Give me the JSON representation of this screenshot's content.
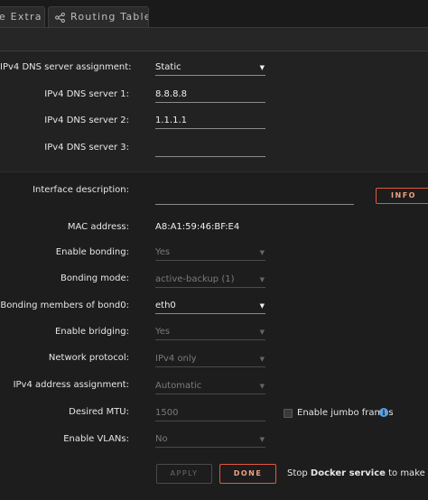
{
  "tabs": [
    {
      "label": "e Extra"
    },
    {
      "label": "Routing Table",
      "icon": "share-icon"
    }
  ],
  "dns": {
    "assignment_label": "IPv4 DNS server assignment:",
    "assignment_value": "Static",
    "server1_label": "IPv4 DNS server 1:",
    "server1_value": "8.8.8.8",
    "server2_label": "IPv4 DNS server 2:",
    "server2_value": "1.1.1.1",
    "server3_label": "IPv4 DNS server 3:",
    "server3_value": ""
  },
  "interface": {
    "description_label": "Interface description:",
    "description_value": "",
    "info_button": "INFO",
    "mac_label": "MAC address:",
    "mac_value": "A8:A1:59:46:BF:E4",
    "bonding_label": "Enable bonding:",
    "bonding_value": "Yes",
    "bonding_mode_label": "Bonding mode:",
    "bonding_mode_value": "active-backup (1)",
    "bond_members_label": "Bonding members of bond0:",
    "bond_members_value": "eth0",
    "bridging_label": "Enable bridging:",
    "bridging_value": "Yes",
    "protocol_label": "Network protocol:",
    "protocol_value": "IPv4 only",
    "ipv4_assign_label": "IPv4 address assignment:",
    "ipv4_assign_value": "Automatic",
    "mtu_label": "Desired MTU:",
    "mtu_placeholder": "1500",
    "jumbo_label": "Enable jumbo frames",
    "jumbo_checked": false,
    "vlans_label": "Enable VLANs:",
    "vlans_value": "No"
  },
  "actions": {
    "apply_label": "APPLY",
    "done_label": "DONE",
    "stop_prefix": "Stop ",
    "stop_bold": "Docker service",
    "stop_suffix": " to make chan"
  },
  "colors": {
    "accent": "#e2583e",
    "help": "#5aa0e8",
    "background": "#1d1d1d"
  }
}
